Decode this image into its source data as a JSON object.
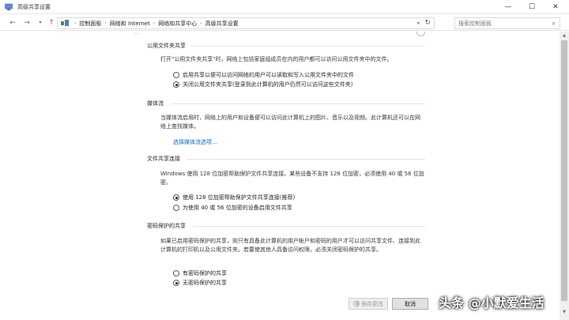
{
  "window": {
    "title": "高级共享设置",
    "controls": {
      "minimize": "—",
      "maximize": "☐",
      "close": "✕"
    }
  },
  "navigation": {
    "breadcrumb": [
      "控制面板",
      "网络和 Internet",
      "网络和共享中心",
      "高级共享设置"
    ],
    "search_placeholder": "搜索控制面板"
  },
  "partial_top_text": "...",
  "sections": {
    "public_folder": {
      "title": "公用文件夹共享",
      "description": "打开\"公用文件夹共享\"时，网络上包括家庭组成员在内的用户都可以访问公用文件夹中的文件。",
      "options": [
        {
          "label": "启用共享以便可以访问网络的用户可以读取和写入公用文件夹中的文件",
          "checked": false
        },
        {
          "label": "关闭公用文件夹共享(登录到此计算机的用户仍然可以访问这些文件夹)",
          "checked": true
        }
      ]
    },
    "media_streaming": {
      "title": "媒体流",
      "description": "当媒体流启用时，网络上的用户和设备便可以访问此计算机上的图片、音乐以及视频。此计算机还可以在网络上查找媒体。",
      "link": "选择媒体流选项..."
    },
    "file_sharing": {
      "title": "文件共享连接",
      "description": "Windows 使用 128 位加密帮助保护文件共享连接。某些设备不支持 128 位加密，必须使用 40 或 56 位加密。",
      "options": [
        {
          "label": "使用 128 位加密帮助保护文件共享连接(推荐)",
          "checked": true
        },
        {
          "label": "为使用 40 或 56 位加密的设备启用文件共享",
          "checked": false
        }
      ]
    },
    "password_sharing": {
      "title": "密码保护的共享",
      "description": "如果已启用密码保护的共享，则只有具备此计算机的用户帐户和密码的用户才可以访问共享文件、连接到此计算机的打印机以及公用文件夹。若要使其他人具备访问权限，必须关闭密码保护的共享。",
      "options": [
        {
          "label": "有密码保护的共享",
          "checked": false
        },
        {
          "label": "无密码保护的共享",
          "checked": true
        }
      ]
    }
  },
  "buttons": {
    "save": "保存更改",
    "cancel": "取消"
  },
  "watermark": "头条 @小默爱生活"
}
